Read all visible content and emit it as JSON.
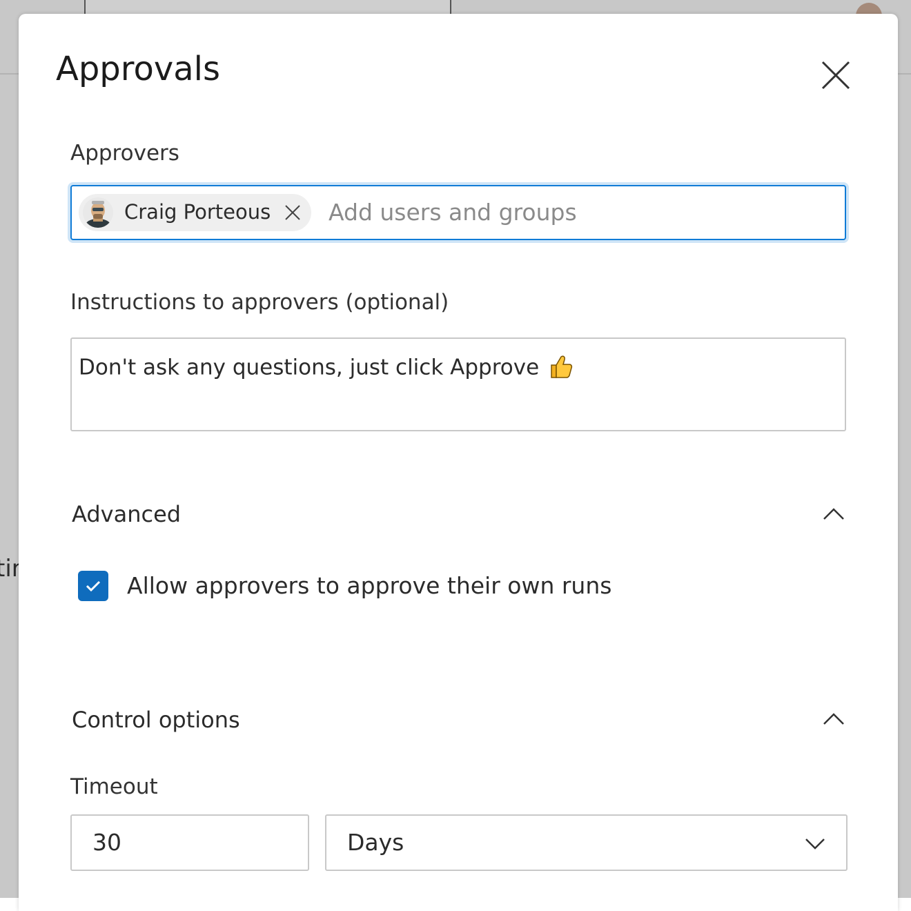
{
  "background": {
    "partial_text": "tir"
  },
  "panel": {
    "title": "Approvals",
    "close_icon": "close-icon"
  },
  "approvers": {
    "label": "Approvers",
    "chips": [
      {
        "name": "Craig Porteous",
        "remove_icon": "close-icon"
      }
    ],
    "placeholder": "Add users and groups",
    "value": ""
  },
  "instructions": {
    "label": "Instructions to approvers (optional)",
    "value": "Don't ask any questions, just click Approve",
    "emoji": "thumbs-up-icon"
  },
  "advanced": {
    "title": "Advanced",
    "expanded": true,
    "allow_self_approve": {
      "label": "Allow approvers to approve their own runs",
      "checked": true
    }
  },
  "control_options": {
    "title": "Control options",
    "expanded": true,
    "timeout": {
      "label": "Timeout",
      "value": "30",
      "unit": "Days",
      "unit_icon": "chevron-down-icon"
    }
  },
  "colors": {
    "accent": "#0f6cbd",
    "focus_border": "#0f7bd6",
    "text": "#2b2b2b"
  }
}
